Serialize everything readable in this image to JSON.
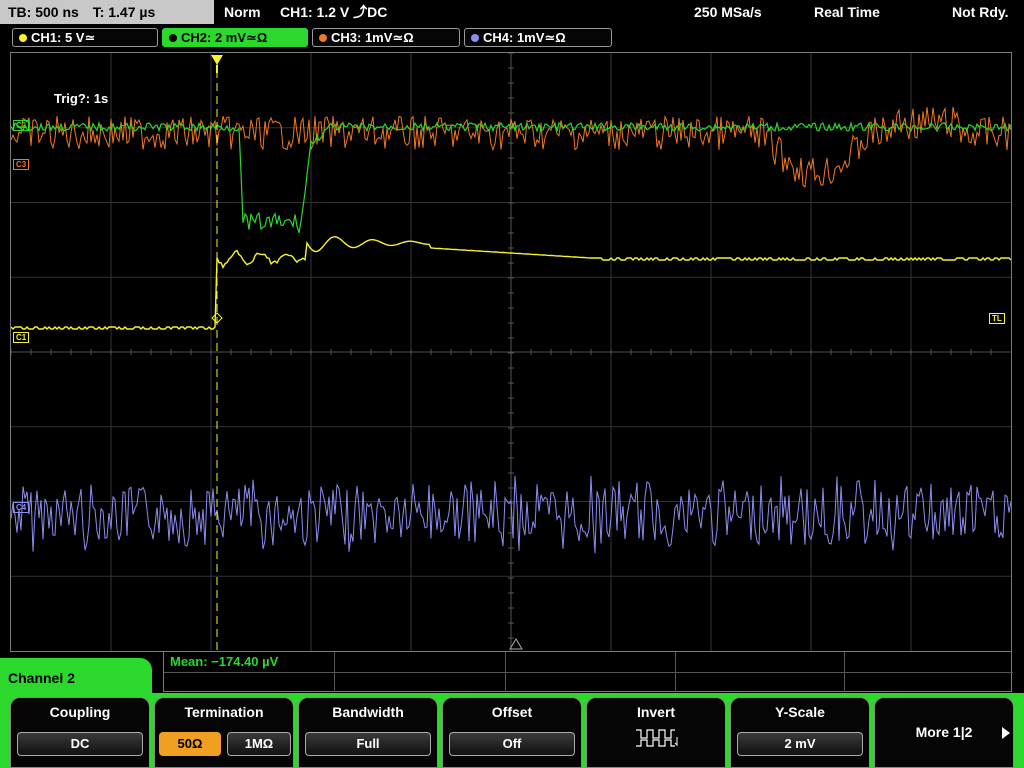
{
  "topbar": {
    "timebase": "TB: 500 ns",
    "trigger_time": "T: 1.47 µs",
    "trigger_mode": "Norm",
    "trigger_source": "CH1: 1.2 V ⤴DC",
    "sample_rate": "250 MSa/s",
    "acq_mode": "Real Time",
    "status": "Not Rdy."
  },
  "channels": [
    {
      "label": "CH1: 5 V≃",
      "color": "#f8f32b"
    },
    {
      "label": "CH2: 2 mV≃Ω",
      "color": "#2bd82b"
    },
    {
      "label": "CH3: 1mV≃Ω",
      "color": "#f07820"
    },
    {
      "label": "CH4: 1mV≃Ω",
      "color": "#8c8cf0"
    }
  ],
  "screen": {
    "trig_timer": "Trig?: 1s",
    "markers": {
      "c2": "C2",
      "c3": "C3",
      "c1": "C1",
      "c4": "C4",
      "tl": "TL"
    }
  },
  "measurement": {
    "mean": "Mean: −174.40 µV"
  },
  "menu": {
    "channel": "Channel 2",
    "coupling": {
      "title": "Coupling",
      "value": "DC"
    },
    "termination": {
      "title": "Termination",
      "opt1": "50Ω",
      "opt2": "1MΩ"
    },
    "bandwidth": {
      "title": "Bandwidth",
      "value": "Full"
    },
    "offset": {
      "title": "Offset",
      "value": "Off"
    },
    "invert": {
      "title": "Invert"
    },
    "yscale": {
      "title": "Y-Scale",
      "value": "2 mV"
    },
    "more": {
      "label": "More 1|2"
    }
  },
  "colors": {
    "accent": "#2bd82b",
    "selected": "#f0a020",
    "grid": "#3a3a3a"
  }
}
